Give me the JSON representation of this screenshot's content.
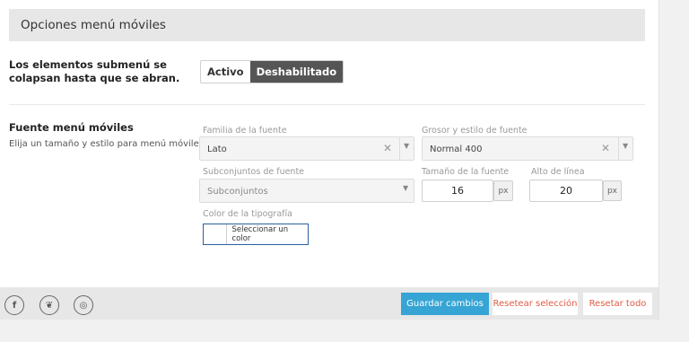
{
  "section": {
    "title": "Opciones menú móviles"
  },
  "submenu_option": {
    "label": "Los elementos submenú se colapsan hasta que se abran.",
    "toggle": {
      "on_label": "Activo",
      "off_label": "Deshabilitado",
      "selected": "Deshabilitado"
    }
  },
  "font_option": {
    "label": "Fuente menú móviles",
    "description": "Elija un tamaño y estilo para menú móviles",
    "family": {
      "label": "Familia de la fuente",
      "value": "Lato"
    },
    "weight": {
      "label": "Grosor y estilo de fuente",
      "value": "Normal 400"
    },
    "subsets": {
      "label": "Subconjuntos de fuente",
      "placeholder": "Subconjuntos"
    },
    "size": {
      "label": "Tamaño de la fuente",
      "value": "16",
      "unit": "px"
    },
    "line_height": {
      "label": "Alto de línea",
      "value": "20",
      "unit": "px"
    },
    "color": {
      "label": "Color de la tipografía",
      "button_label": "Seleccionar un color",
      "value": "#ffffff"
    }
  },
  "footer": {
    "social": [
      {
        "icon": "facebook-icon",
        "glyph": "f"
      },
      {
        "icon": "twitter-icon",
        "glyph": "❦"
      },
      {
        "icon": "instagram-icon",
        "glyph": "◎"
      }
    ],
    "save_label": "Guardar cambios",
    "reset_section_label": "Resetear selección",
    "reset_all_label": "Resetar todo"
  },
  "colors": {
    "accent": "#36a5d5",
    "danger_link": "#e05a44",
    "toggle_selected": "#555555",
    "color_picker_border": "#2d5f9e"
  }
}
